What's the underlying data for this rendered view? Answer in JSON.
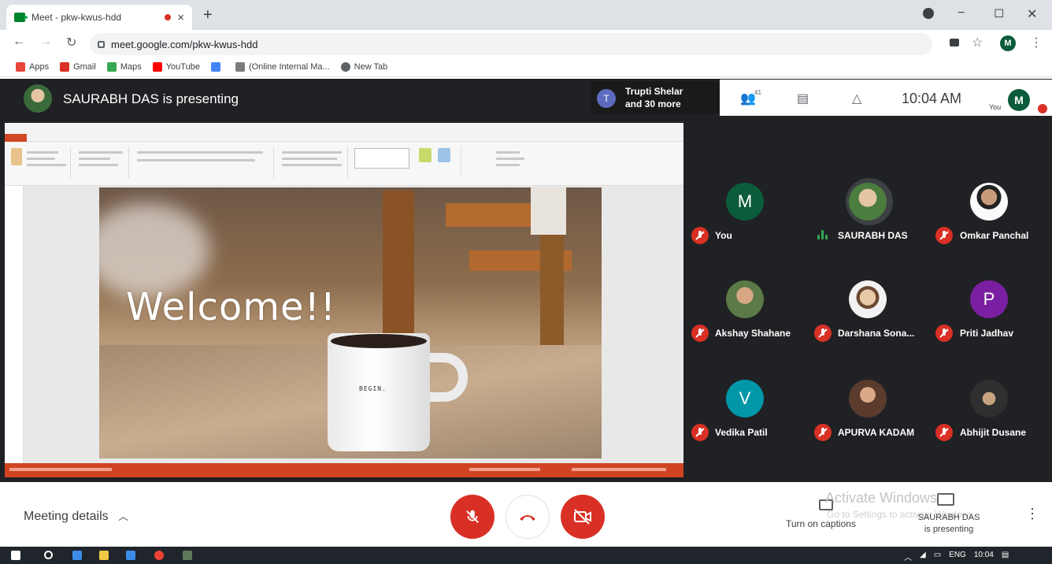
{
  "browser": {
    "tab_title": "Meet - pkw-kwus-hdd",
    "tab_close": "×",
    "new_tab": "+",
    "url": "meet.google.com/pkw-kwus-hdd",
    "profile_initial": "M",
    "bookmarks": [
      {
        "label": "Apps",
        "color": "#e8453c"
      },
      {
        "label": "Gmail",
        "color": "#d93025"
      },
      {
        "label": "Maps",
        "color": "#34a853"
      },
      {
        "label": "YouTube",
        "color": "#ff0000"
      },
      {
        "label": "",
        "color": "#4285f4"
      },
      {
        "label": "(Online Internal Ma...",
        "color": "#7b7b7b"
      },
      {
        "label": "New Tab",
        "color": "#5f6368"
      }
    ]
  },
  "meet": {
    "presenter_banner": "SAURABH DAS is presenting",
    "pinned_user": {
      "initial": "T",
      "line1": "Trupti Shelar",
      "line2": "and 30 more"
    },
    "participant_count": "41",
    "time": "10:04 AM",
    "self_label": "You",
    "self_initial": "M"
  },
  "slide": {
    "title": "Welcome!!",
    "mug_text": "BEGIN."
  },
  "participants": [
    {
      "name": "You",
      "initial": "M",
      "color": "#0b5c3a",
      "muted": true
    },
    {
      "name": "SAURABH DAS",
      "initial": "",
      "color": "#3a6a3a",
      "muted": false,
      "speaking": true
    },
    {
      "name": "Omkar Panchal",
      "initial": "",
      "color": "#f2f2f2",
      "muted": true
    },
    {
      "name": "Akshay Shahane",
      "initial": "",
      "color": "#5b7a47",
      "muted": true
    },
    {
      "name": "Darshana Sona...",
      "initial": "",
      "color": "#e6d9c9",
      "muted": true
    },
    {
      "name": "Priti Jadhav",
      "initial": "P",
      "color": "#7b1fa2",
      "muted": true
    },
    {
      "name": "Vedika Patil",
      "initial": "V",
      "color": "#0097a7",
      "muted": true
    },
    {
      "name": "APURVA KADAM",
      "initial": "",
      "color": "#6d4c41",
      "muted": true
    },
    {
      "name": "Abhijit Dusane",
      "initial": "",
      "color": "#4a4a4a",
      "muted": true
    }
  ],
  "bottom": {
    "meeting_details": "Meeting details",
    "captions_label": "Turn on captions",
    "presenting_line1": "SAURABH DAS",
    "presenting_line2": "is presenting",
    "watermark_line1": "Activate Windows",
    "watermark_line2": "Go to Settings to activate Windows."
  },
  "taskbar": {
    "lang": "ENG",
    "time": "10:04"
  },
  "colors": {
    "accent_red": "#d93025",
    "meet_dark": "#202124",
    "ppt_orange": "#d04423"
  }
}
